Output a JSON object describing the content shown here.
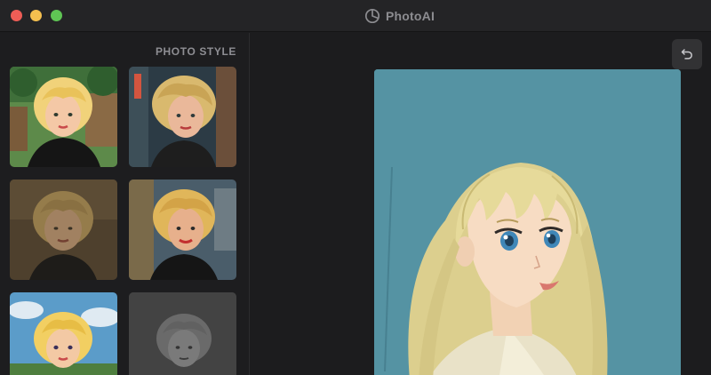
{
  "window": {
    "title": "PhotoAI",
    "controls": [
      "close",
      "minimize",
      "maximize"
    ],
    "colors": {
      "close": "#ee5d56",
      "minimize": "#f4bf4f",
      "maximize": "#5fc554"
    }
  },
  "sidebar": {
    "heading": "PHOTO STYLE",
    "styles": [
      {
        "icon": "cartoon-portrait-garden-thumbnail"
      },
      {
        "icon": "comic-portrait-night-street-thumbnail"
      },
      {
        "icon": "sepia-soft-painting-thumbnail"
      },
      {
        "icon": "pop-art-portrait-thumbnail"
      },
      {
        "icon": "bright-cartoon-sky-thumbnail"
      },
      {
        "icon": "grayscale-photo-thumbnail"
      }
    ]
  },
  "toolbar": {
    "undo_icon": "undo-icon"
  },
  "preview": {
    "icon": "anime-portrait-blonde-girl"
  }
}
